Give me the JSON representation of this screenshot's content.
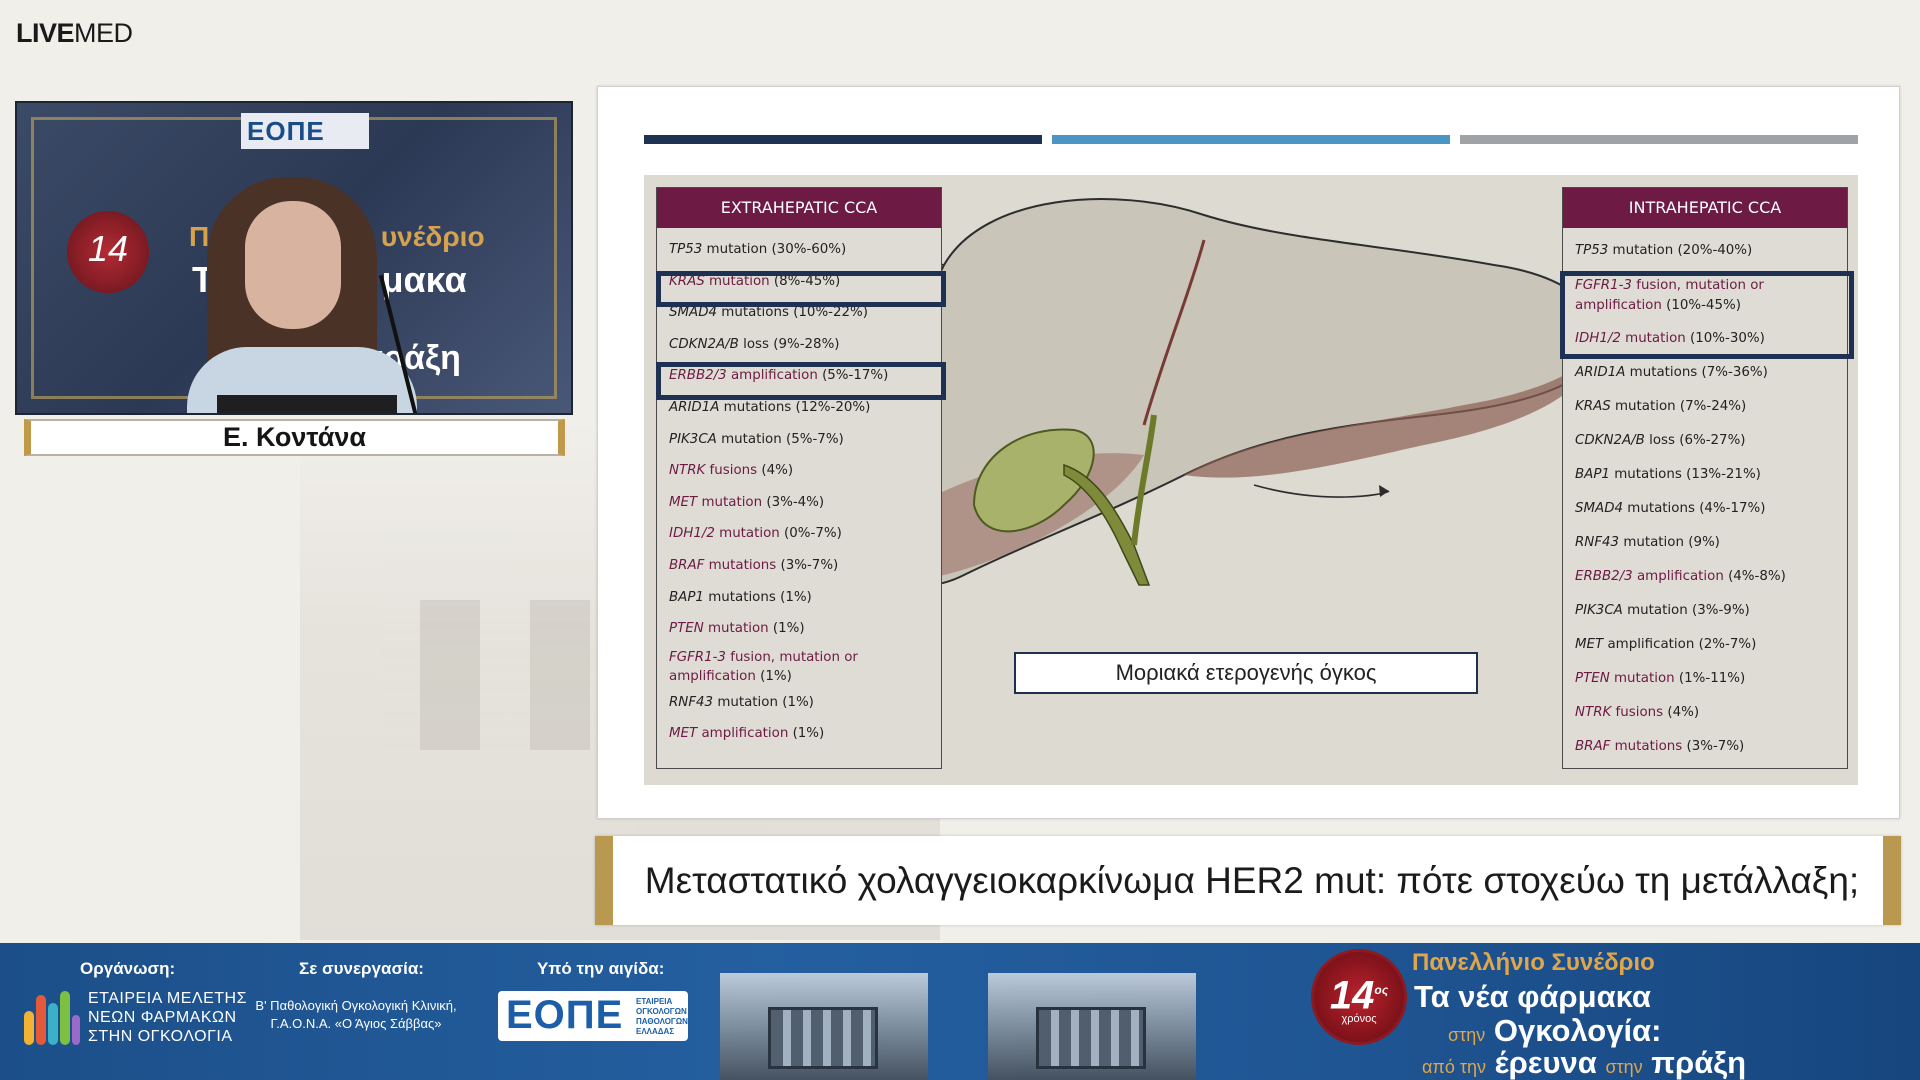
{
  "brand": {
    "logo_bold": "LIVE",
    "logo_thin": "MED"
  },
  "speaker": {
    "name": "Ε. Κοντάνα"
  },
  "video": {
    "badge": "ΕΟΠΕ",
    "seal_number": "14",
    "line1": "Πανελ",
    "line1b": "υνέδριο",
    "line2": "Τα ν",
    "line2b": "μακα",
    "line3": "πράξη"
  },
  "slide": {
    "left_panel": {
      "title": "EXTRAHEPATIC CCA",
      "items": [
        {
          "gene": "TP53",
          "text": " mutation ",
          "value": "(30%-60%)",
          "m": false
        },
        {
          "gene": "KRAS",
          "text": " mutation ",
          "value": "(8%-45%)",
          "m": true
        },
        {
          "gene": "SMAD4",
          "text": " mutations ",
          "value": "(10%-22%)",
          "m": false
        },
        {
          "gene": "CDKN2A/B",
          "text": " loss ",
          "value": "(9%-28%)",
          "m": false
        },
        {
          "gene": "ERBB2/3",
          "text": " amplification ",
          "value": "(5%-17%)",
          "m": true
        },
        {
          "gene": "ARID1A",
          "text": " mutations ",
          "value": "(12%-20%)",
          "m": false
        },
        {
          "gene": "PIK3CA",
          "text": " mutation ",
          "value": "(5%-7%)",
          "m": false
        },
        {
          "gene": "NTRK",
          "text": " fusions ",
          "value": "(4%)",
          "m": true
        },
        {
          "gene": "MET",
          "text": " mutation ",
          "value": "(3%-4%)",
          "m": true
        },
        {
          "gene": "IDH1/2",
          "text": " mutation ",
          "value": "(0%-7%)",
          "m": true
        },
        {
          "gene": "BRAF",
          "text": " mutations ",
          "value": "(3%-7%)",
          "m": true
        },
        {
          "gene": "BAP1",
          "text": " mutations ",
          "value": "(1%)",
          "m": false
        },
        {
          "gene": "PTEN",
          "text": " mutation ",
          "value": "(1%)",
          "m": true
        },
        {
          "gene": "FGFR1-3",
          "text": " fusion, mutation or amplification ",
          "value": "(1%)",
          "m": true,
          "two": true
        },
        {
          "gene": "RNF43",
          "text": " mutation ",
          "value": "(1%)",
          "m": false
        },
        {
          "gene": "MET",
          "text": " amplification ",
          "value": "(1%)",
          "m": true
        }
      ]
    },
    "right_panel": {
      "title": "INTRAHEPATIC CCA",
      "items": [
        {
          "gene": "TP53",
          "text": " mutation ",
          "value": "(20%-40%)",
          "m": false
        },
        {
          "gene": "FGFR1-3",
          "text": " fusion, mutation or amplification ",
          "value": "(10%-45%)",
          "m": true,
          "two": true
        },
        {
          "gene": "IDH1/2",
          "text": " mutation ",
          "value": "(10%-30%)",
          "m": true
        },
        {
          "gene": "ARID1A",
          "text": " mutations ",
          "value": "(7%-36%)",
          "m": false
        },
        {
          "gene": "KRAS",
          "text": " mutation ",
          "value": "(7%-24%)",
          "m": false
        },
        {
          "gene": "CDKN2A/B",
          "text": " loss ",
          "value": "(6%-27%)",
          "m": false
        },
        {
          "gene": "BAP1",
          "text": " mutations ",
          "value": "(13%-21%)",
          "m": false
        },
        {
          "gene": "SMAD4",
          "text": " mutations ",
          "value": "(4%-17%)",
          "m": false
        },
        {
          "gene": "RNF43",
          "text": " mutation ",
          "value": "(9%)",
          "m": false
        },
        {
          "gene": "ERBB2/3",
          "text": " amplification ",
          "value": "(4%-8%)",
          "m": true
        },
        {
          "gene": "PIK3CA",
          "text": " mutation ",
          "value": "(3%-9%)",
          "m": false
        },
        {
          "gene": "MET",
          "text": " amplification ",
          "value": "(2%-7%)",
          "m": false
        },
        {
          "gene": "PTEN",
          "text": " mutation ",
          "value": "(1%-11%)",
          "m": true
        },
        {
          "gene": "NTRK",
          "text": " fusions ",
          "value": "(4%)",
          "m": true
        },
        {
          "gene": "BRAF",
          "text": " mutations ",
          "value": "(3%-7%)",
          "m": true
        }
      ]
    },
    "caption": "Μοριακά ετερογενής όγκος"
  },
  "lower_title": "Μεταστατικό χολαγγειοκαρκίνωμα HER2 mut: πότε στοχεύω τη μετάλλαξη;",
  "footer": {
    "organizer_label": "Οργάνωση:",
    "organizer_lines": [
      "ΕΤΑΙΡΕΙΑ ΜΕΛΕΤΗΣ",
      "ΝΕΩΝ ΦΑΡΜΑΚΩΝ",
      "ΣΤΗΝ ΟΓΚΟΛΟΓΙΑ"
    ],
    "collab_label": "Σε συνεργασία:",
    "collab_text": "Β' Παθολογική Ογκολογική Κλινική, Γ.Α.Ο.Ν.Α. «Ο Άγιος Σάββας»",
    "auspices_label": "Υπό την αιγίδα:",
    "eope_big": "ΕΟΠΕ",
    "eope_small": "ΕΤΑΙΡΕΙΑ ΟΓΚΟΛΟΓΩΝ ΠΑΘΟΛΟΓΩΝ ΕΛΛΑΔΑΣ",
    "seal_number": "14",
    "seal_sup": "ος",
    "seal_sub": "χρόνος",
    "conf_line1": "Πανελλήνιο Συνέδριο",
    "conf_line2": "Τα νέα φάρμακα",
    "conf_line3_small": "στην",
    "conf_line3": "Ογκολογία:",
    "conf_line4_small1": "από την",
    "conf_line4_mid": "έρευνα",
    "conf_line4_small2": "στην",
    "conf_line4_end": "πράξη"
  },
  "colors": {
    "accent_gold": "#c09a48",
    "panel_head": "#6d1b44",
    "box_navy": "#1f3152",
    "footer_blue": "#245fa0"
  }
}
